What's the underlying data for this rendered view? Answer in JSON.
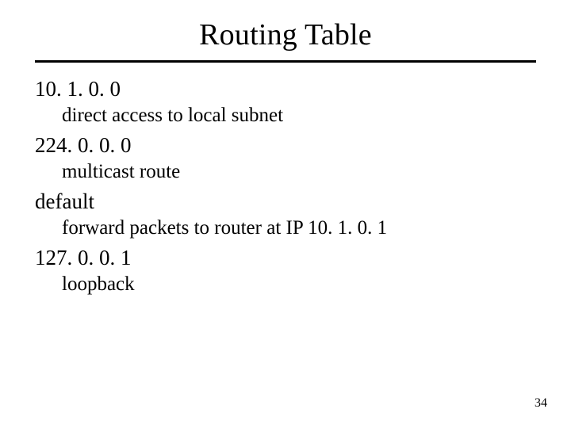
{
  "title": "Routing Table",
  "entries": [
    {
      "address": "10. 1. 0. 0",
      "description": "direct access to local subnet"
    },
    {
      "address": "224. 0. 0. 0",
      "description": "multicast route"
    },
    {
      "address": "default",
      "description": "forward packets to router at IP 10. 1. 0. 1"
    },
    {
      "address": "127. 0. 0. 1",
      "description": "loopback"
    }
  ],
  "page_number": "34"
}
